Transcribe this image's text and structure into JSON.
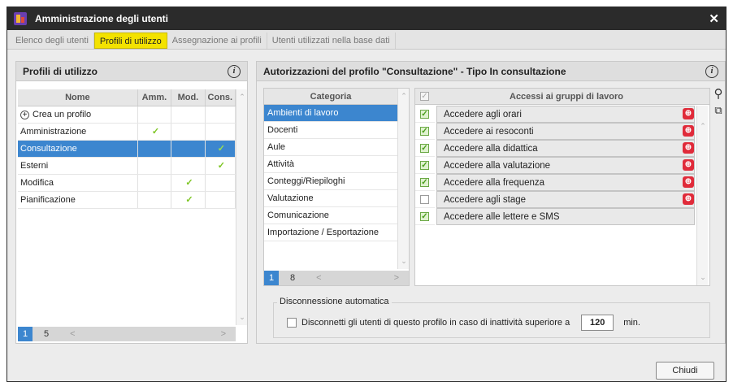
{
  "window": {
    "title": "Amministrazione degli utenti",
    "close_glyph": "✕"
  },
  "tabs": [
    {
      "label": "Elenco degli utenti",
      "active": false
    },
    {
      "label": "Profili di utilizzo",
      "active": true
    },
    {
      "label": "Assegnazione ai profili",
      "active": false
    },
    {
      "label": "Utenti utilizzati nella base dati",
      "active": false
    }
  ],
  "left_panel": {
    "title": "Profili di utilizzo",
    "columns": [
      "Nome",
      "Amm.",
      "Mod.",
      "Cons."
    ],
    "create_label": "Crea un profilo",
    "rows": [
      {
        "name": "Amministrazione",
        "amm": true,
        "mod": false,
        "cons": false,
        "selected": false
      },
      {
        "name": "Consultazione",
        "amm": false,
        "mod": false,
        "cons": true,
        "selected": true
      },
      {
        "name": "Esterni",
        "amm": false,
        "mod": false,
        "cons": true,
        "selected": false
      },
      {
        "name": "Modifica",
        "amm": false,
        "mod": true,
        "cons": false,
        "selected": false
      },
      {
        "name": "Pianificazione",
        "amm": false,
        "mod": true,
        "cons": false,
        "selected": false
      }
    ],
    "pager": {
      "current": "1",
      "total": "5"
    }
  },
  "right_panel": {
    "title": "Autorizzazioni del profilo \"Consultazione\" - Tipo In consultazione",
    "category_header": "Categoria",
    "categories": [
      {
        "label": "Ambienti di lavoro",
        "selected": true
      },
      {
        "label": "Docenti",
        "selected": false
      },
      {
        "label": "Aule",
        "selected": false
      },
      {
        "label": "Attività",
        "selected": false
      },
      {
        "label": "Conteggi/Riepiloghi",
        "selected": false
      },
      {
        "label": "Valutazione",
        "selected": false
      },
      {
        "label": "Comunicazione",
        "selected": false
      },
      {
        "label": "Importazione / Esportazione",
        "selected": false
      }
    ],
    "category_pager": {
      "current": "1",
      "total": "8"
    },
    "access_header": "Accessi ai gruppi di lavoro",
    "accesses": [
      {
        "label": "Accedere agli orari",
        "checked": true,
        "badge": true
      },
      {
        "label": "Accedere ai resoconti",
        "checked": true,
        "badge": true
      },
      {
        "label": "Accedere alla didattica",
        "checked": true,
        "badge": true
      },
      {
        "label": "Accedere alla valutazione",
        "checked": true,
        "badge": true
      },
      {
        "label": "Accedere alla frequenza",
        "checked": true,
        "badge": true
      },
      {
        "label": "Accedere agli stage",
        "checked": false,
        "badge": true
      },
      {
        "label": "Accedere alle lettere e SMS",
        "checked": true,
        "badge": false
      }
    ],
    "disconnect": {
      "legend": "Disconnessione automatica",
      "label": "Disconnetti gli utenti di questo profilo in caso di inattività superiore a",
      "value": "120",
      "unit": "min.",
      "checked": false
    }
  },
  "footer": {
    "close_label": "Chiudi"
  },
  "colors": {
    "selection": "#3c86cf",
    "active_tab": "#f3e200",
    "check": "#7cc522",
    "badge": "#e02b3a"
  }
}
